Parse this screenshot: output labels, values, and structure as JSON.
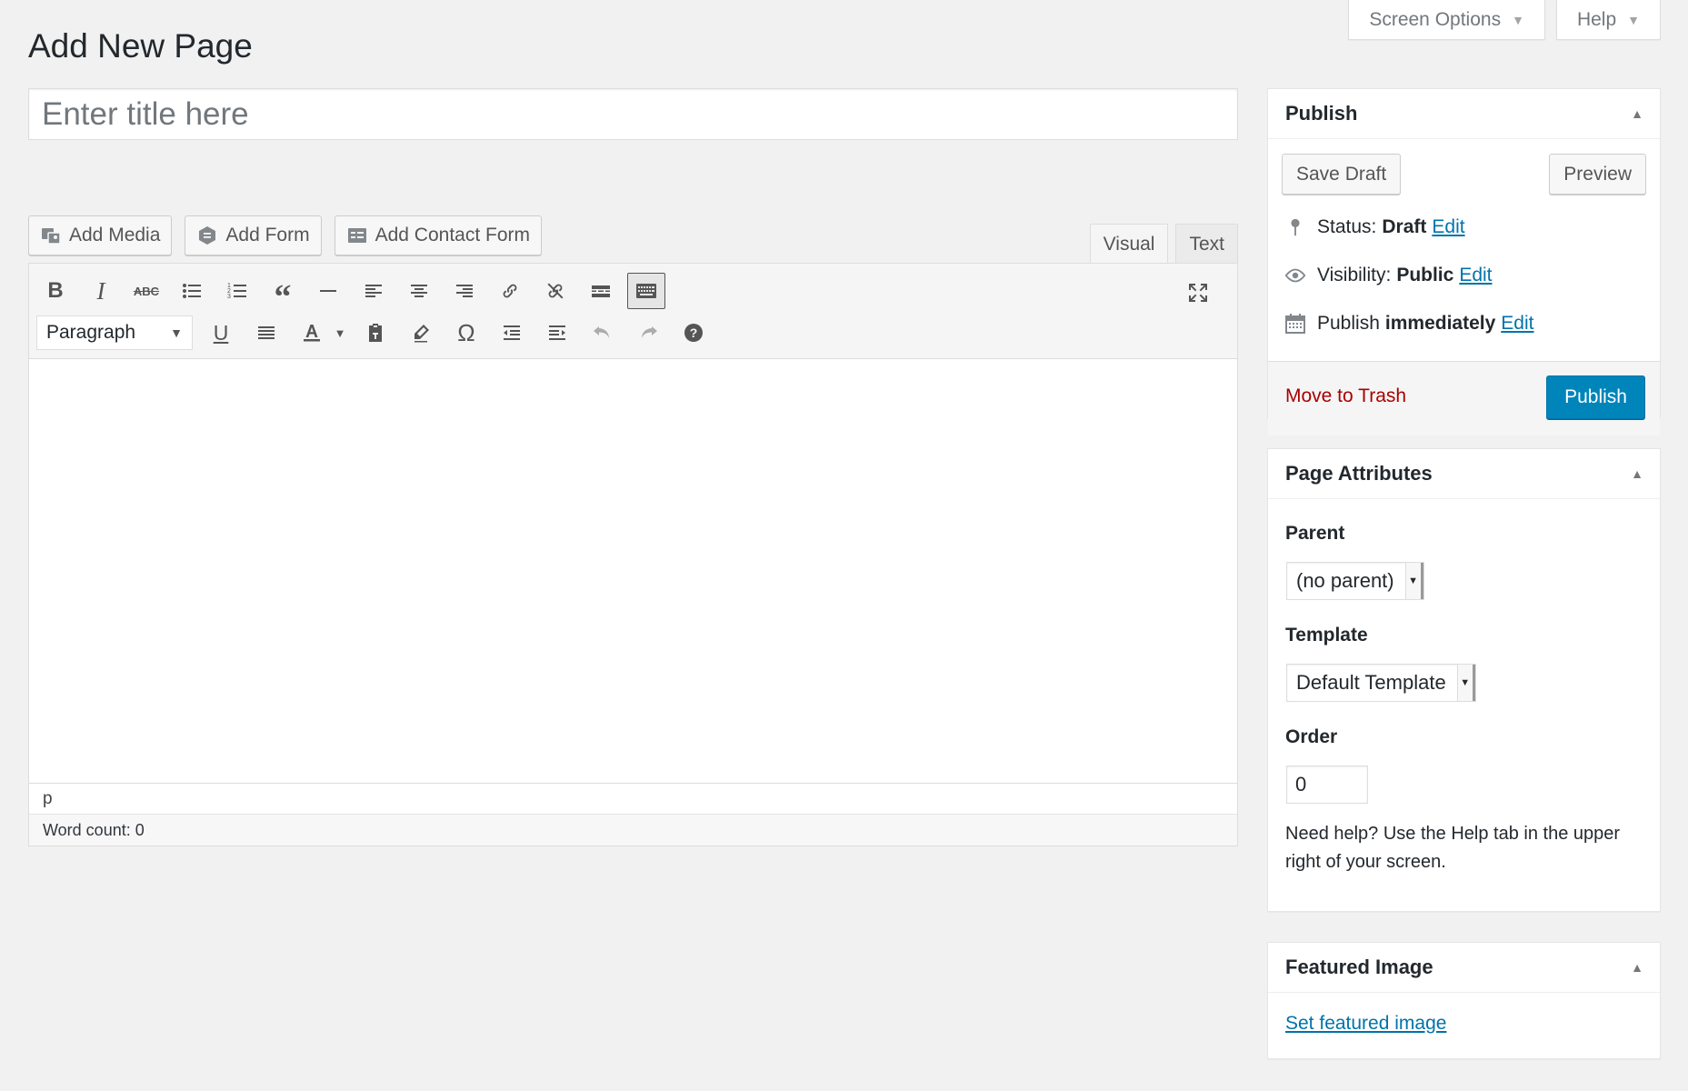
{
  "header": {
    "title": "Add New Page",
    "screen_options": "Screen Options",
    "help": "Help"
  },
  "title_field": {
    "placeholder": "Enter title here"
  },
  "media_buttons": {
    "add_media": "Add Media",
    "add_form": "Add Form",
    "add_contact_form": "Add Contact Form"
  },
  "editor_tabs": {
    "visual": "Visual",
    "text": "Text"
  },
  "toolbar": {
    "format_select": "Paragraph",
    "row1_icons": [
      "bold-icon",
      "italic-icon",
      "strikethrough-icon",
      "bullet-list-icon",
      "numbered-list-icon",
      "blockquote-icon",
      "horizontal-line-icon",
      "align-left-icon",
      "align-center-icon",
      "align-right-icon",
      "insert-link-icon",
      "remove-link-icon",
      "read-more-icon",
      "toolbar-toggle-icon"
    ],
    "row2_icons": [
      "underline-icon",
      "justify-icon",
      "text-color-icon",
      "paste-as-text-icon",
      "clear-formatting-icon",
      "special-character-icon",
      "outdent-icon",
      "indent-icon",
      "undo-icon",
      "redo-icon",
      "help-icon"
    ]
  },
  "editor": {
    "path": "p",
    "word_count": "Word count: 0"
  },
  "publish_box": {
    "title": "Publish",
    "save_draft": "Save Draft",
    "preview": "Preview",
    "status_label": "Status:",
    "status_value": "Draft",
    "visibility_label": "Visibility:",
    "visibility_value": "Public",
    "publish_label": "Publish",
    "publish_value": "immediately",
    "edit": "Edit",
    "move_to_trash": "Move to Trash",
    "publish_button": "Publish"
  },
  "page_attributes": {
    "title": "Page Attributes",
    "parent_label": "Parent",
    "parent_value": "(no parent)",
    "template_label": "Template",
    "template_value": "Default Template",
    "order_label": "Order",
    "order_value": "0",
    "help_text": "Need help? Use the Help tab in the upper right of your screen."
  },
  "featured_image": {
    "title": "Featured Image",
    "link": "Set featured image"
  },
  "colors": {
    "primary": "#0085ba",
    "link": "#0073aa",
    "trash": "#aa0000",
    "background": "#f1f1f1"
  }
}
